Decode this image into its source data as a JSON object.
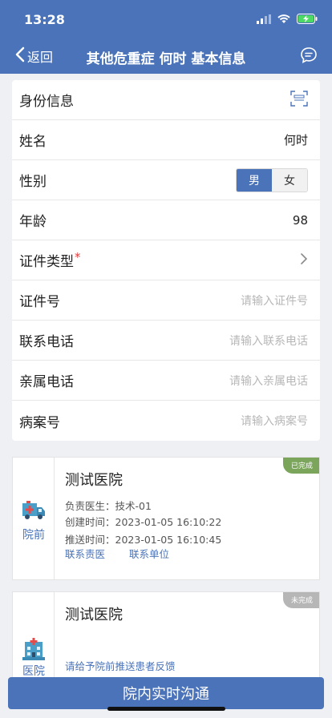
{
  "status": {
    "time": "13:28"
  },
  "nav": {
    "back_label": "返回",
    "title": "其他危重症 何时 基本信息"
  },
  "form": {
    "id_section_label": "身份信息",
    "name_label": "姓名",
    "name_value": "何时",
    "gender_label": "性别",
    "gender_male": "男",
    "gender_female": "女",
    "gender_selected": "男",
    "age_label": "年龄",
    "age_value": "98",
    "idtype_label": "证件类型",
    "required_mark": "*",
    "idno_label": "证件号",
    "idno_placeholder": "请输入证件号",
    "phone_label": "联系电话",
    "phone_placeholder": "请输入联系电话",
    "relphone_label": "亲属电话",
    "relphone_placeholder": "请输入亲属电话",
    "case_label": "病案号",
    "case_placeholder": "请输入病案号"
  },
  "cards": [
    {
      "stage": "院前",
      "hospital": "测试医院",
      "status": "已完成",
      "doctor_label": "负责医生：",
      "doctor": "技术-01",
      "created_label": "创建时间：",
      "created": "2023-01-05 16:10:22",
      "pushed_label": "推送时间：",
      "pushed": "2023-01-05 16:10:45",
      "link1": "联系责医",
      "link2": "联系单位"
    },
    {
      "stage": "医院",
      "hospital": "测试医院",
      "status": "未完成",
      "feedback": "请给予院前推送患者反馈"
    }
  ],
  "bottom_button": "院内实时沟通",
  "colors": {
    "primary": "#4a73b9",
    "done": "#7aa55b",
    "pending": "#b6b6b6",
    "required": "#e23b3b"
  }
}
